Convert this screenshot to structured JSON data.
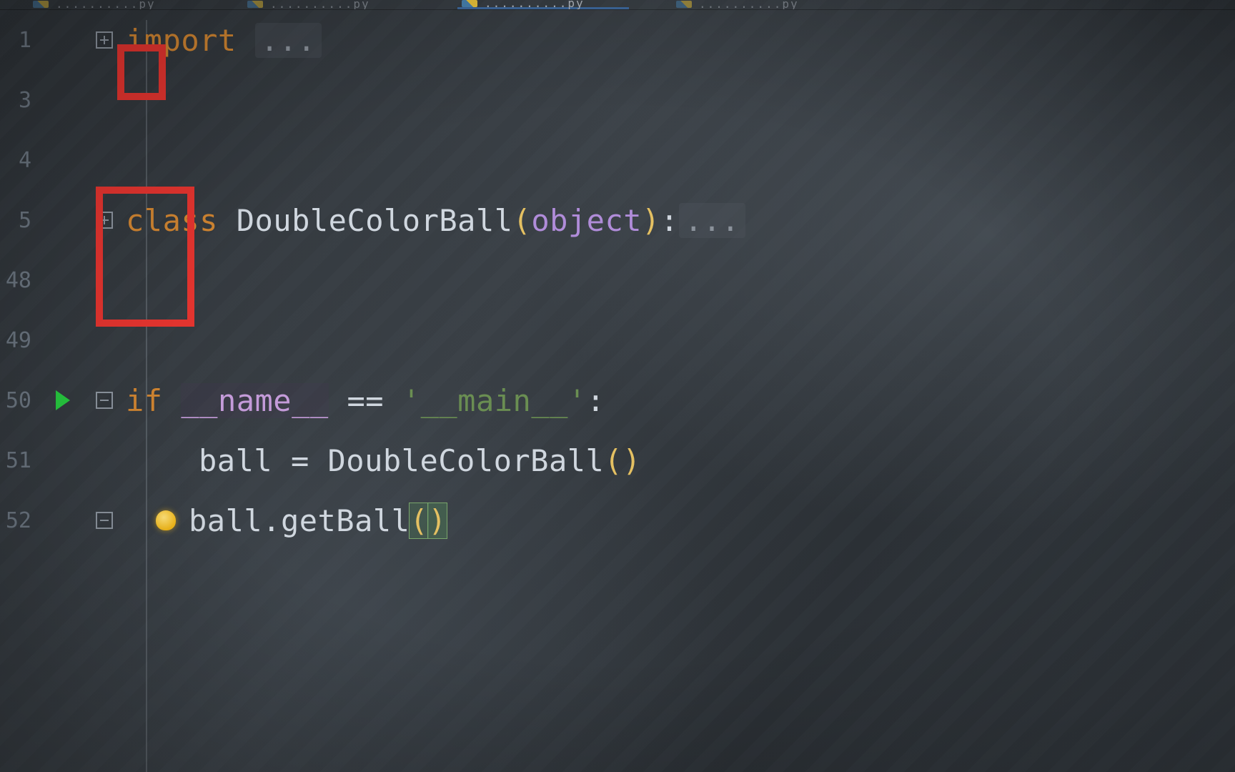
{
  "tabs": [
    {
      "label": "..........py",
      "active": false
    },
    {
      "label": "..........py",
      "active": false
    },
    {
      "label": "..........py",
      "active": true
    },
    {
      "label": "..........py",
      "active": false
    }
  ],
  "gutter": {
    "line_numbers": [
      "1",
      "3",
      "4",
      "5",
      "48",
      "49",
      "50",
      "51",
      "52"
    ]
  },
  "code": {
    "line_import": {
      "kw": "import",
      "rest": " ",
      "ellipsis": "..."
    },
    "line_class": {
      "kw": "class",
      "sp": " ",
      "name": "DoubleColorBall",
      "lparen": "(",
      "param": "object",
      "rparen": ")",
      "colon": ":",
      "ellipsis": "..."
    },
    "line_ifmain": {
      "kw": "if",
      "sp": " ",
      "dunder": "__name__",
      "eq": " == ",
      "str": "'__main__'",
      "colon": ":"
    },
    "line_assign": {
      "lhs": "ball",
      "eq": " = ",
      "cls": "DoubleColorBall",
      "lparen": "(",
      "rparen": ")"
    },
    "line_call": {
      "obj": "ball",
      "dot": ".",
      "fn": "getBall",
      "lparen": "(",
      "rparen": ")"
    }
  },
  "annotations": {
    "red_box_small": true,
    "red_box_large": true
  },
  "colors": {
    "keyword": "#cf8431",
    "string": "#6a8e52",
    "dunder": "#c49bd9",
    "param": "#b08cd9",
    "paren": "#e4c062",
    "run_triangle": "#27c93f",
    "bulb": "#f0b71a",
    "annotation_red": "#e3342f"
  }
}
